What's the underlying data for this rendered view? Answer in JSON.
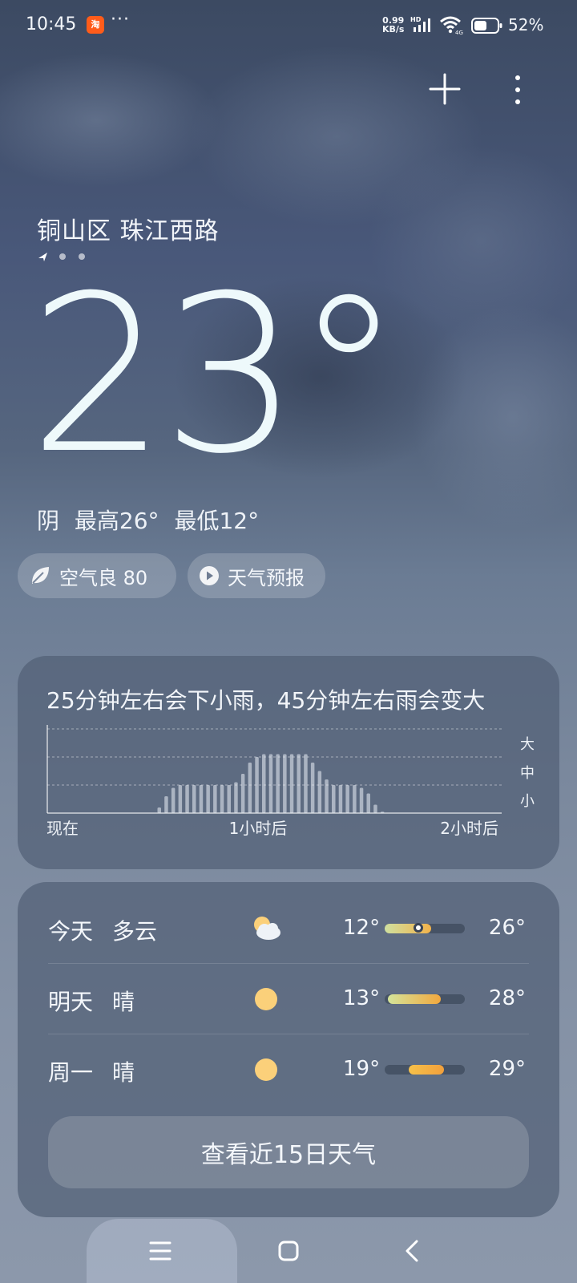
{
  "status_bar": {
    "time": "10:45",
    "app_badge": "淘",
    "more": "···",
    "net_speed_value": "0.99",
    "net_speed_unit": "KB/s",
    "hd": "HD",
    "battery_percent": "52%"
  },
  "location": {
    "name": "铜山区 珠江西路",
    "pages": 3,
    "current_page": 0
  },
  "current": {
    "temperature": "23°",
    "condition": "阴",
    "high": "最高26°",
    "low": "最低12°"
  },
  "chips": {
    "aqi": "空气良 80",
    "forecast": "天气预报"
  },
  "rain": {
    "title": "25分钟左右会下小雨，45分钟左右雨会变大",
    "levels": [
      "大",
      "中",
      "小"
    ],
    "x_labels": [
      "现在",
      "1小时后",
      "2小时后"
    ]
  },
  "chart_data": {
    "type": "bar",
    "title": "25分钟左右会下小雨，45分钟左右雨会变大",
    "xlabel": "",
    "ylabel": "",
    "x_ticks": [
      "现在",
      "1小时后",
      "2小时后"
    ],
    "y_ticks": [
      "小",
      "中",
      "大"
    ],
    "ylim": [
      0,
      3
    ],
    "grid": true,
    "values": [
      0,
      0,
      0,
      0,
      0,
      0,
      0,
      0,
      0,
      0,
      0,
      0,
      0,
      0,
      0,
      0.2,
      0.6,
      0.9,
      1,
      1,
      1,
      1,
      1,
      1,
      1,
      1,
      1.1,
      1.4,
      1.8,
      2.0,
      2.1,
      2.1,
      2.1,
      2.1,
      2.1,
      2.1,
      2.1,
      1.8,
      1.5,
      1.2,
      1,
      1,
      1,
      1,
      0.9,
      0.7,
      0.3,
      0.05,
      0,
      0,
      0,
      0,
      0,
      0,
      0,
      0,
      0,
      0,
      0,
      0,
      0
    ]
  },
  "daily": [
    {
      "day": "今天",
      "condition": "多云",
      "icon": "partly-cloudy-icon",
      "low": "12°",
      "high": "26°",
      "bar_start": 0.0,
      "bar_end": 0.58,
      "current_pos": 0.42,
      "colors": [
        "#cfe0a0",
        "#f2b24a"
      ]
    },
    {
      "day": "明天",
      "condition": "晴",
      "icon": "sun-icon",
      "low": "13°",
      "high": "28°",
      "bar_start": 0.04,
      "bar_end": 0.7,
      "colors": [
        "#d4e49a",
        "#f2a83e"
      ]
    },
    {
      "day": "周一",
      "condition": "晴",
      "icon": "sun-icon",
      "low": "19°",
      "high": "29°",
      "bar_start": 0.3,
      "bar_end": 0.74,
      "colors": [
        "#f6c14a",
        "#f2a03c"
      ]
    }
  ],
  "more_days_button": "查看近15日天气",
  "colors": {
    "sun": "#fbd07a",
    "temp_text": "#eef9fb"
  }
}
